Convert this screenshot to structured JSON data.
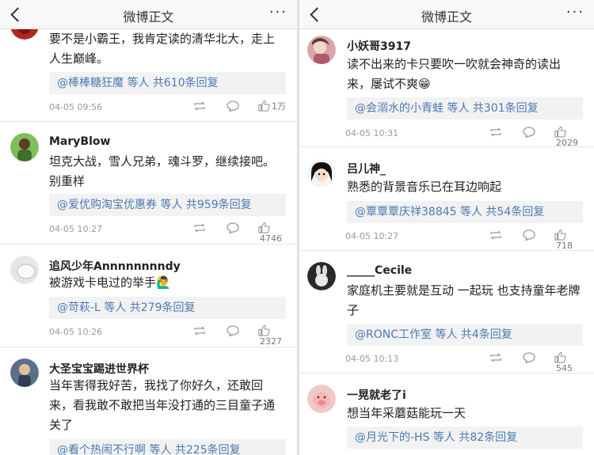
{
  "header": {
    "title": "微博正文",
    "more": "···"
  },
  "left_comments": [
    {
      "name": "",
      "body": "要不是小霸王，我肯定读的清华北大，走上人生巅峰。",
      "replies": "@棒棒糖狂魔 等人 共610条回复",
      "time": "04-05 09:56",
      "likes": "1万"
    },
    {
      "name": "MaryBlow",
      "body": "坦克大战，雪人兄弟，魂斗罗，继续接吧。别重样",
      "replies": "@爱优购淘宝优惠券 等人 共959条回复",
      "time": "04-05 10:27",
      "likes": "4746"
    },
    {
      "name": "追风少年Annnnnnnndy",
      "body": "被游戏卡电过的举手🙋‍♂️",
      "replies": "@苛萩-L 等人 共279条回复",
      "time": "04-05 10:26",
      "likes": "2327"
    },
    {
      "name": "大圣宝宝踢进世界杯",
      "body": "当年害得我好苦，我找了你好久，还敢回来，看我敢不敢把当年没打通的三目童子通关了",
      "replies": "@看个热闹不行啊 等人 共225条回复",
      "time": "",
      "likes": ""
    }
  ],
  "right_comments": [
    {
      "name": "小妖哥3917",
      "body": "读不出来的卡只要吹一吹就会神奇的读出来，屡试不爽😁",
      "replies": "@会溺水的小青蛙 等人 共301条回复",
      "time": "04-05 10:31",
      "likes": "2029"
    },
    {
      "name": "吕儿神_",
      "body": "熟悉的背景音乐已在耳边响起",
      "replies": "@覃覃覃庆祥38845 等人 共54条回复",
      "time": "04-05 10:27",
      "likes": "718"
    },
    {
      "name": "_____Cecile",
      "body": "家庭机主要就是互动 一起玩 也支持童年老牌子",
      "replies": "@RONC工作室 等人 共4条回复",
      "time": "04-05 10:13",
      "likes": "545"
    },
    {
      "name": "一晃就老了i",
      "body": "想当年采蘑菇能玩一天",
      "replies": "@月光下的-HS 等人 共82条回复",
      "time": "",
      "likes": ""
    }
  ],
  "colors": {
    "link": "#4a7ab3",
    "reply_bg": "#f2f2f2"
  }
}
